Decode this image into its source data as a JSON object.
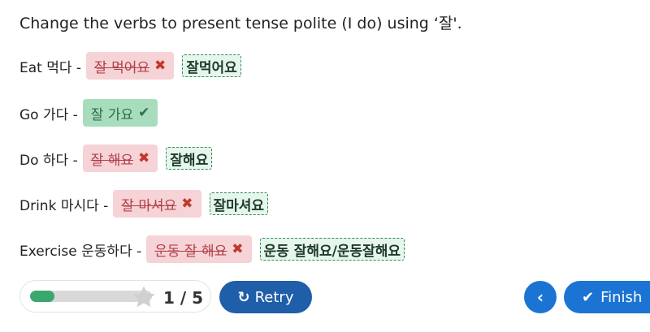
{
  "instruction": "Change the verbs to present tense polite (I do) using ‘잘'.",
  "rows": [
    {
      "prompt": "Eat 먹다 -",
      "answer": "잘 먹어요",
      "status": "wrong",
      "correction": "잘먹어요"
    },
    {
      "prompt": "Go 가다 -",
      "answer": "잘 가요",
      "status": "correct",
      "correction": ""
    },
    {
      "prompt": "Do 하다 -",
      "answer": "잘 해요",
      "status": "wrong",
      "correction": "잘해요"
    },
    {
      "prompt": "Drink 마시다 -",
      "answer": "잘 마셔요",
      "status": "wrong",
      "correction": "잘마셔요"
    },
    {
      "prompt": "Exercise 운동하다 -",
      "answer": "운동 잘 해요",
      "status": "wrong",
      "correction": "운동 잘해요/운동잘해요"
    }
  ],
  "icons": {
    "wrong": "✖",
    "correct": "✔",
    "retry": "redo-icon",
    "prev": "chevron-left-icon",
    "finish": "check-icon",
    "star": "star-icon"
  },
  "progress": {
    "label": "1 / 5",
    "fraction": 0.2
  },
  "buttons": {
    "retry": "Retry",
    "finish": "Finish"
  },
  "colors": {
    "wrong_bg": "#f6d3d6",
    "right_bg": "#a7ddbc",
    "accent": "#1b74d4",
    "progress": "#3aa76d"
  }
}
